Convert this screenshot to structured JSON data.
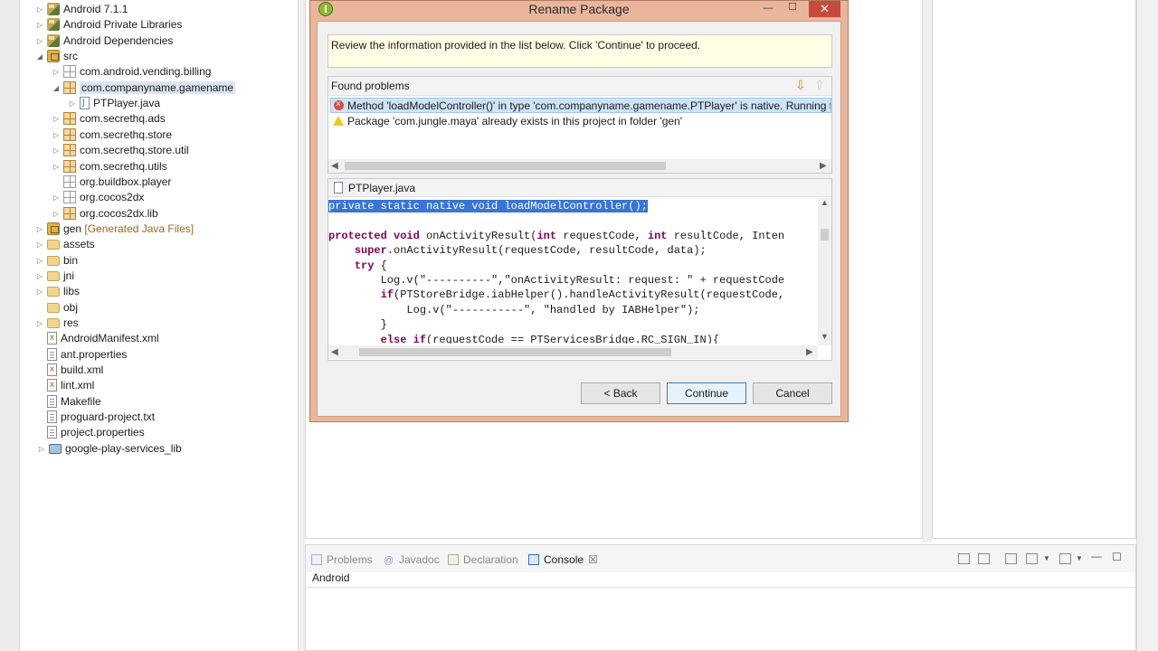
{
  "explorer": {
    "items": [
      {
        "label": "Android 7.1.1",
        "icon": "library-icon",
        "toggle": "▷",
        "indent": 1
      },
      {
        "label": "Android Private Libraries",
        "icon": "library-icon",
        "toggle": "▷",
        "indent": 1
      },
      {
        "label": "Android Dependencies",
        "icon": "library-icon",
        "toggle": "▷",
        "indent": 1
      },
      {
        "label": "src",
        "icon": "source-folder-icon",
        "toggle": "◢",
        "indent": 1
      },
      {
        "label": "com.android.vending.billing",
        "icon": "empty-package-icon",
        "toggle": "▷",
        "indent": 2
      },
      {
        "label": "com.companyname.gamename",
        "icon": "package-icon",
        "toggle": "◢",
        "indent": 2,
        "selected": true
      },
      {
        "label": "PTPlayer.java",
        "icon": "java-file-icon",
        "toggle": "▷",
        "indent": 3
      },
      {
        "label": "com.secrethq.ads",
        "icon": "package-icon",
        "toggle": "▷",
        "indent": 2
      },
      {
        "label": "com.secrethq.store",
        "icon": "package-icon",
        "toggle": "▷",
        "indent": 2
      },
      {
        "label": "com.secrethq.store.util",
        "icon": "package-icon",
        "toggle": "▷",
        "indent": 2
      },
      {
        "label": "com.secrethq.utils",
        "icon": "package-icon",
        "toggle": "▷",
        "indent": 2
      },
      {
        "label": "org.buildbox.player",
        "icon": "empty-package-icon",
        "toggle": "",
        "indent": 2
      },
      {
        "label": "org.cocos2dx",
        "icon": "empty-package-icon",
        "toggle": "▷",
        "indent": 2
      },
      {
        "label": "org.cocos2dx.lib",
        "icon": "package-icon",
        "toggle": "▷",
        "indent": 2
      },
      {
        "label": "gen",
        "deco": "[Generated Java Files]",
        "icon": "source-folder-icon",
        "toggle": "▷",
        "indent": 1
      },
      {
        "label": "assets",
        "icon": "folder-icon",
        "toggle": "▷",
        "indent": 1
      },
      {
        "label": "bin",
        "icon": "folder-icon",
        "toggle": "▷",
        "indent": 1
      },
      {
        "label": "jni",
        "icon": "folder-icon",
        "toggle": "▷",
        "indent": 1
      },
      {
        "label": "libs",
        "icon": "folder-icon",
        "toggle": "▷",
        "indent": 1
      },
      {
        "label": "obj",
        "icon": "folder-icon",
        "toggle": "",
        "indent": 1
      },
      {
        "label": "res",
        "icon": "folder-icon",
        "toggle": "▷",
        "indent": 1
      },
      {
        "label": "AndroidManifest.xml",
        "icon": "xml-file-icon",
        "toggle": "",
        "indent": 1
      },
      {
        "label": "ant.properties",
        "icon": "file-icon",
        "toggle": "",
        "indent": 1
      },
      {
        "label": "build.xml",
        "icon": "xml-file-icon",
        "toggle": "",
        "indent": 1
      },
      {
        "label": "lint.xml",
        "icon": "xml-file-icon",
        "toggle": "",
        "indent": 1
      },
      {
        "label": "Makefile",
        "icon": "file-icon",
        "toggle": "",
        "indent": 1
      },
      {
        "label": "proguard-project.txt",
        "icon": "file-icon",
        "toggle": "",
        "indent": 1
      },
      {
        "label": "project.properties",
        "icon": "file-icon",
        "toggle": "",
        "indent": 1
      },
      {
        "label": "google-play-services_lib",
        "icon": "project-icon",
        "toggle": "▷",
        "indent": 0
      }
    ]
  },
  "dialog": {
    "title": "Rename Package",
    "min_glyph": "—",
    "max_glyph": "☐",
    "close_glyph": "✕",
    "info": "Review the information provided in the list below. Click 'Continue' to proceed.",
    "problems_title": "Found problems",
    "problems": [
      {
        "severity": "error",
        "text": "Method 'loadModelController()' in type 'com.companyname.gamename.PTPlayer' is native. Running the"
      },
      {
        "severity": "warning",
        "text": "Package 'com.jungle.maya' already exists in this project in folder 'gen'"
      }
    ],
    "preview_file": "PTPlayer.java",
    "code_lines": [
      {
        "text": "private static native void loadModelController();",
        "selected": true
      },
      {
        "text": ""
      },
      {
        "text": "protected void onActivityResult(int requestCode, int resultCode, Inten"
      },
      {
        "text": "    super.onActivityResult(requestCode, resultCode, data);"
      },
      {
        "text": "    try {"
      },
      {
        "text": "        Log.v(\"----------\",\"onActivityResult: request: \" + requestCode"
      },
      {
        "text": "        if(PTStoreBridge.iabHelper().handleActivityResult(requestCode,"
      },
      {
        "text": "            Log.v(\"-----------\", \"handled by IABHelper\");"
      },
      {
        "text": "        }"
      },
      {
        "text": "        else if(requestCode == PTServicesBridge.RC_SIGN_IN){"
      }
    ],
    "back_label": "< Back",
    "continue_label": "Continue",
    "cancel_label": "Cancel"
  },
  "bottom": {
    "tabs": [
      {
        "label": "Problems",
        "icon": "problems-icon",
        "active": false
      },
      {
        "label": "Javadoc",
        "icon": "javadoc-icon",
        "active": false
      },
      {
        "label": "Declaration",
        "icon": "declaration-icon",
        "active": false
      },
      {
        "label": "Console",
        "icon": "console-icon",
        "active": true,
        "close": "☒"
      }
    ],
    "console_name": "Android"
  },
  "colors": {
    "dialog_frame": "#e9b69c",
    "close_button": "#c74b3b",
    "code_selection": "#3875d7",
    "keyword": "#7f0055"
  }
}
